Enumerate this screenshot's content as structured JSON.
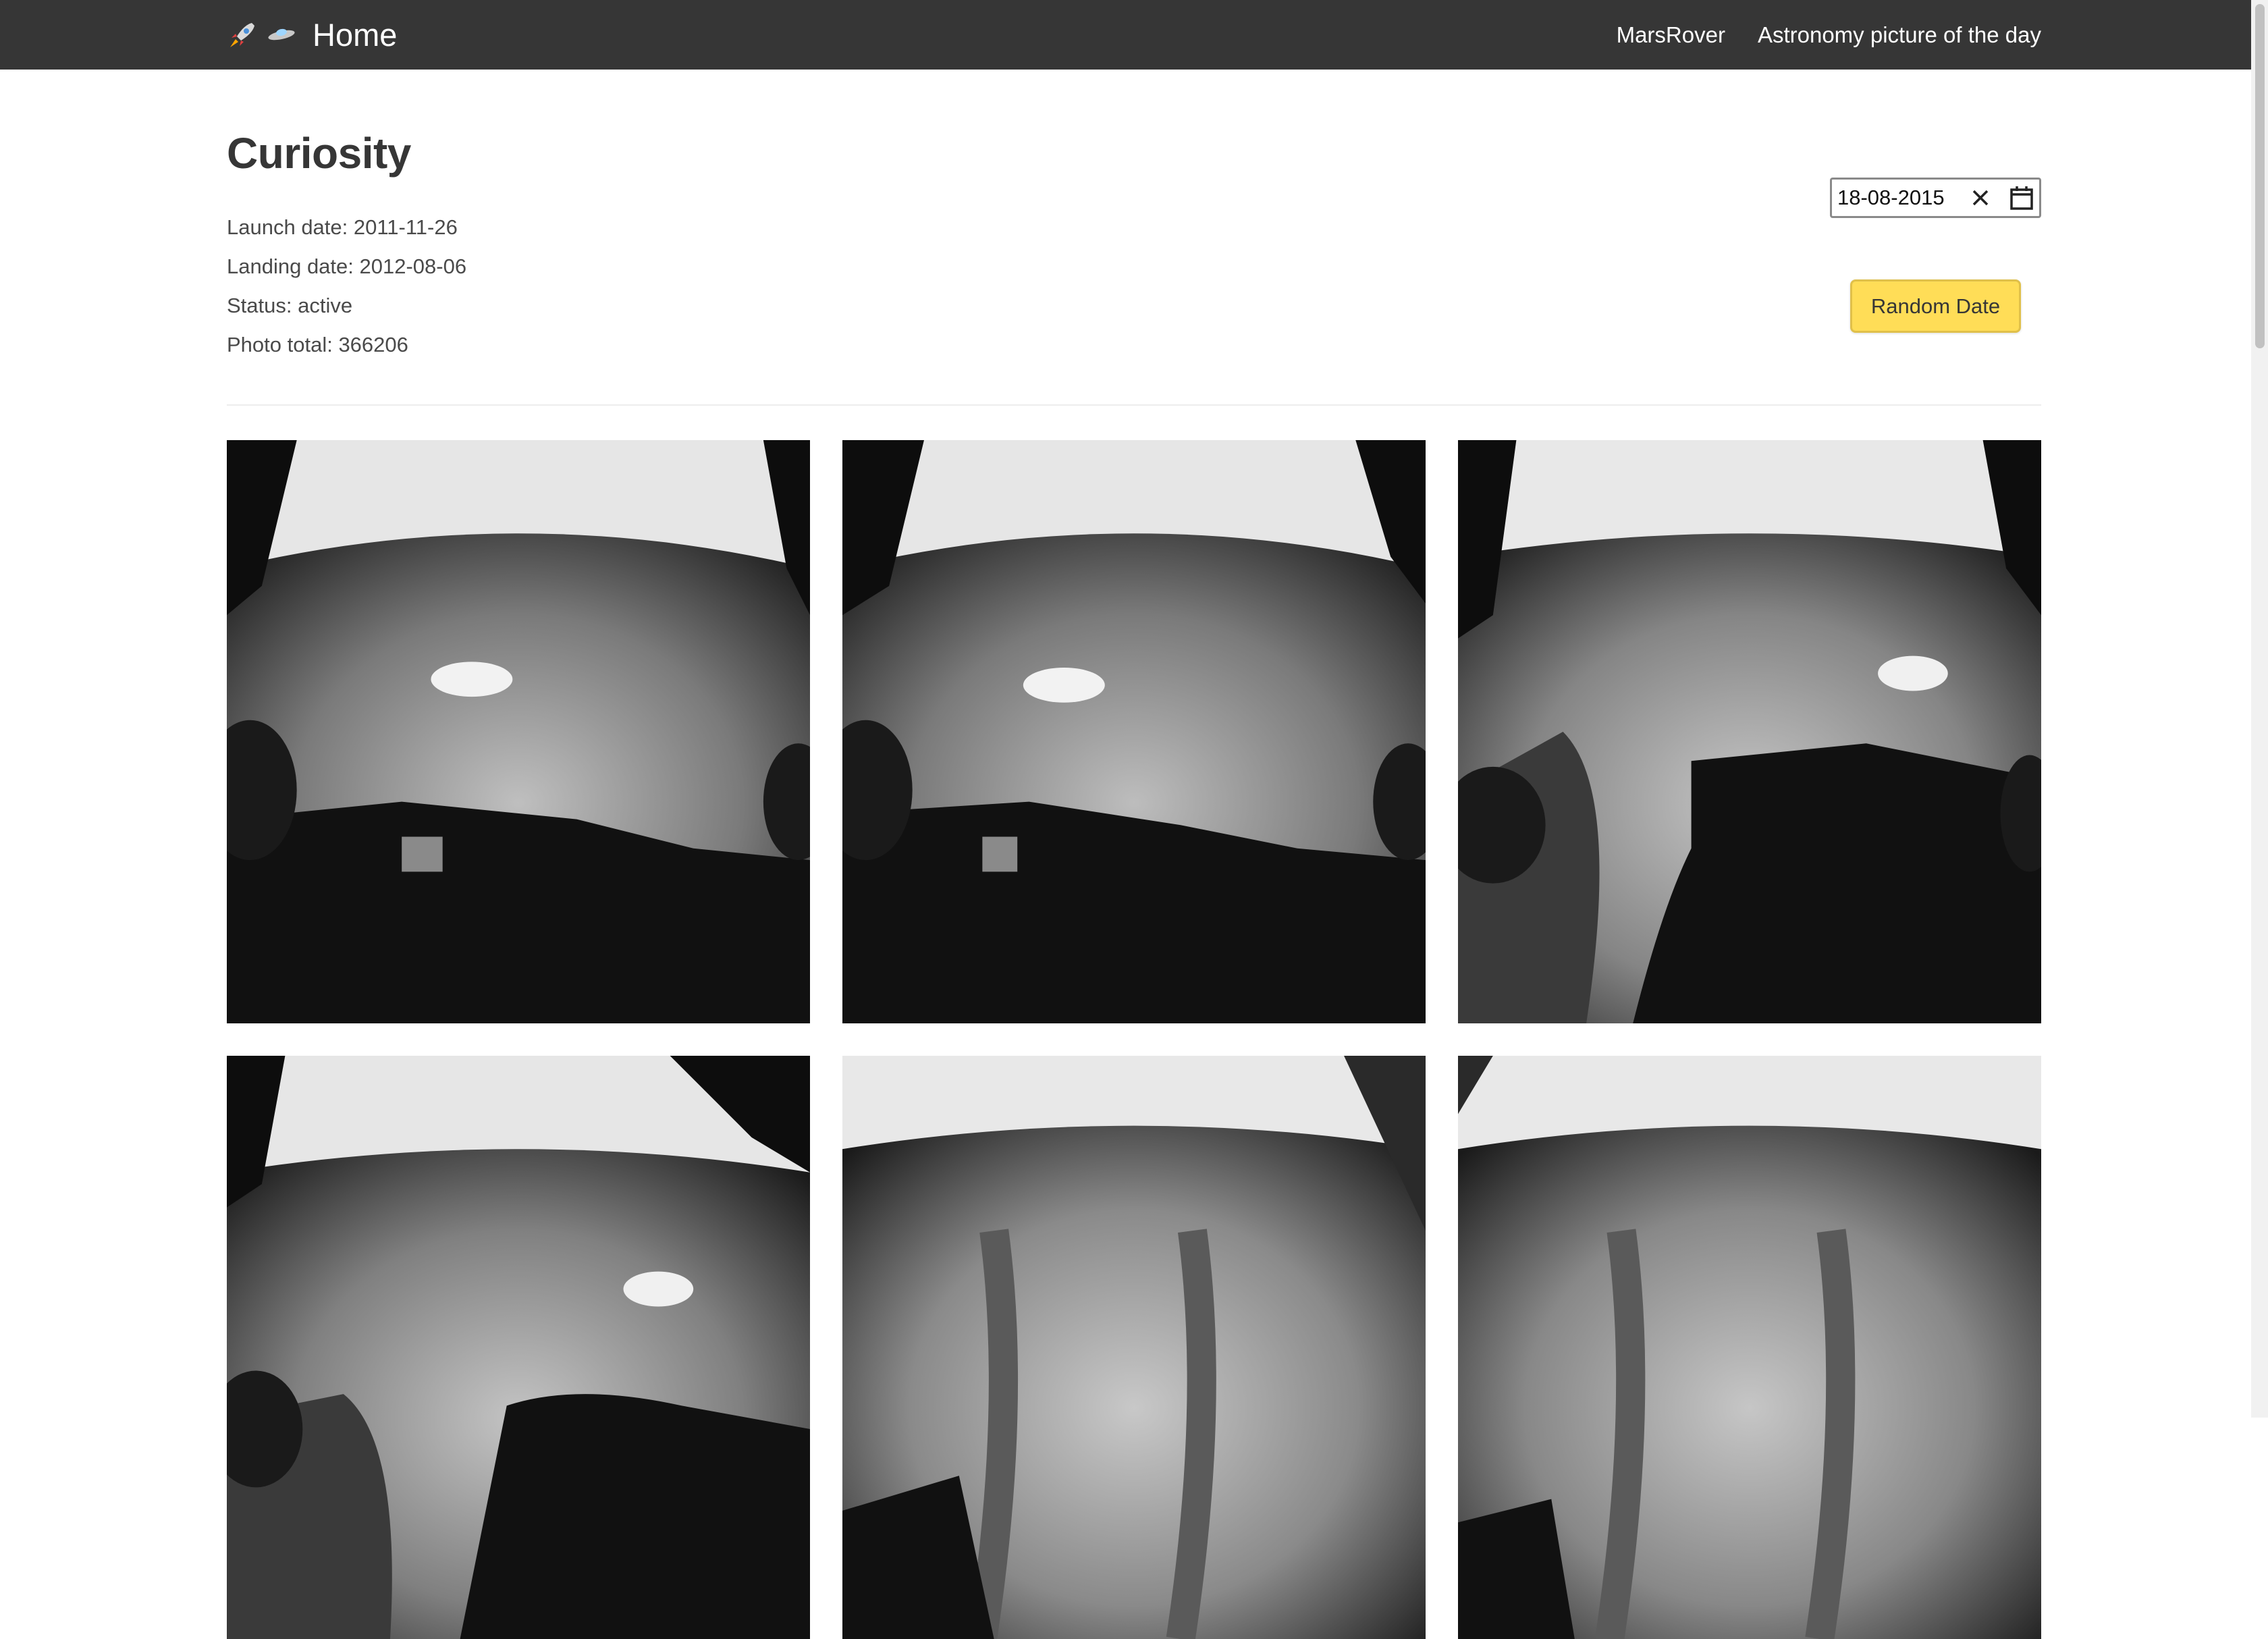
{
  "nav": {
    "brand_label": "Home",
    "links": [
      "MarsRover",
      "Astronomy picture of the day"
    ],
    "icons": [
      "rocket-icon",
      "ufo-icon"
    ]
  },
  "rover": {
    "name": "Curiosity",
    "launch": "Launch date: 2011-11-26",
    "landing": "Landing date: 2012-08-06",
    "status": "Status: active",
    "photos": "Photo total: 366206"
  },
  "date_picker": {
    "value": "18-08-2015"
  },
  "random_button": {
    "label": "Random Date"
  },
  "colors": {
    "navbar": "#363636",
    "button": "#ffdd57"
  }
}
